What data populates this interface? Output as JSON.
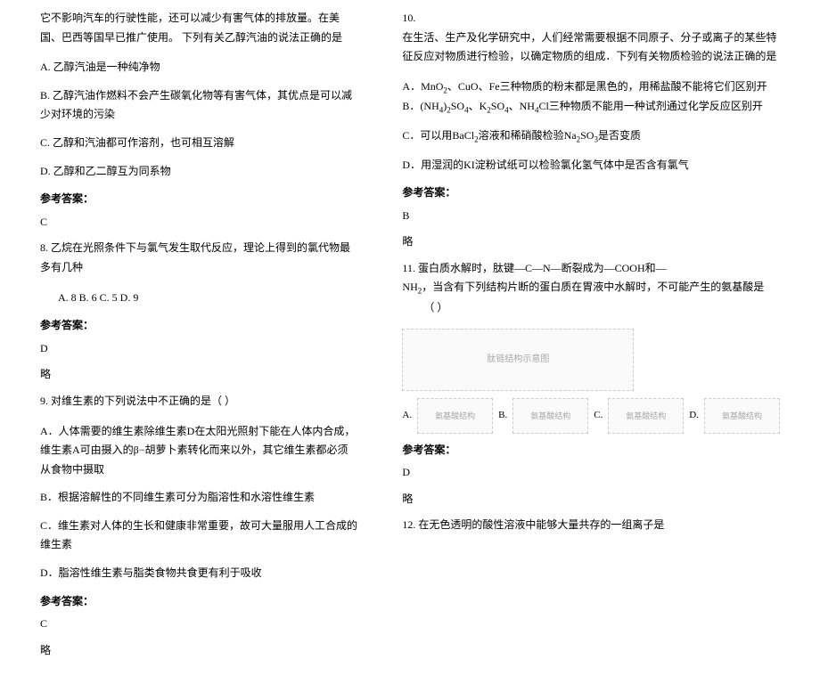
{
  "left": {
    "intro": "它不影响汽车的行驶性能，还可以减少有害气体的排放量。在美国、巴西等国早已推广使用。 下列有关乙醇汽油的说法正确的是",
    "optA": "A. 乙醇汽油是一种纯净物",
    "optB": "B. 乙醇汽油作燃料不会产生碳氧化物等有害气体，其优点是可以减少对环境的污染",
    "optC": "C. 乙醇和汽油都可作溶剂，也可相互溶解",
    "optD": "D. 乙醇和乙二醇互为同系物",
    "ansLabel": "参考答案：",
    "ans": "C",
    "q8": "8. 乙烷在光照条件下与氯气发生取代反应，理论上得到的氯代物最多有几种",
    "q8opts": "A. 8    B. 6    C. 5    D. 9",
    "q8ans": "D",
    "omit": "略",
    "q9": "9. 对维生素的下列说法中不正确的是（   ）",
    "q9A": "A．人体需要的维生素除维生素D在太阳光照射下能在人体内合成，维生素A可由摄入的β−胡萝卜素转化而来以外，其它维生素都必须从食物中摄取",
    "q9B": "B．根据溶解性的不同维生素可分为脂溶性和水溶性维生素",
    "q9C": "C．维生素对人体的生长和健康非常重要，故可大量服用人工合成的维生素",
    "q9D": "D．脂溶性维生素与脂类食物共食更有利于吸收",
    "q9ans": "C"
  },
  "right": {
    "q10num": "10.",
    "q10": "在生活、生产及化学研究中，人们经常需要根据不同原子、分子或离子的某些特征反应对物质进行检验，以确定物质的组成．下列有关物质检验的说法正确的是",
    "q10A_a": "A．MnO",
    "q10A_b": "、CuO、Fe三种物质的粉末都是黑色的，用稀盐酸不能将它们区别开",
    "q10B_a": "B．(NH",
    "q10B_b": ")",
    "q10B_c": "SO",
    "q10B_d": "、K",
    "q10B_e": "SO",
    "q10B_f": "、NH",
    "q10B_g": "Cl三种物质不能用一种试剂通过化学反应区别开",
    "q10C_a": "C．可以用BaCl",
    "q10C_b": "溶液和稀硝酸检验Na",
    "q10C_c": "SO",
    "q10C_d": "是否变质",
    "q10D": "D．用湿润的KI淀粉试纸可以检验氯化氢气体中是否含有氯气",
    "ansLabel": "参考答案：",
    "q10ans": "B",
    "omit": "略",
    "q11a": "11. 蛋白质水解时，肽键—C—N—断裂成为—COOH和—",
    "q11b": "NH",
    "q11c": "，当含有下列结构片断的蛋白质在胃液中水解时，不可能产生的氨基酸是",
    "q11blank": "（   ）",
    "structImgAlt": "肽链结构示意图",
    "optA": "A.",
    "optB": "B.",
    "optC": "C.",
    "optD": "D.",
    "optImgAlt": "氨基酸结构",
    "q11ans": "D",
    "q12": "12. 在无色透明的酸性溶液中能够大量共存的一组离子是"
  }
}
